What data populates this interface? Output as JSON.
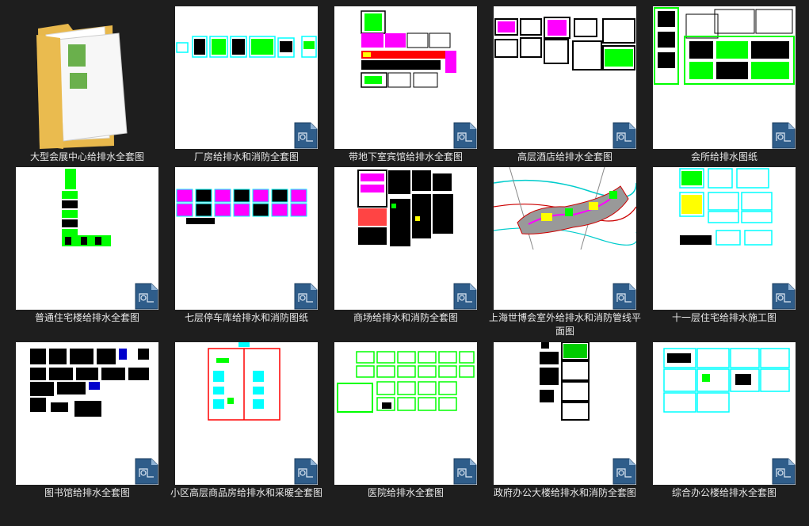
{
  "files": [
    {
      "name": "大型会展中心给排水全套图",
      "kind": "folder"
    },
    {
      "name": "厂房给排水和消防全套图",
      "kind": "dwg"
    },
    {
      "name": "带地下室宾馆给排水全套图",
      "kind": "dwg"
    },
    {
      "name": "高层酒店给排水全套图",
      "kind": "dwg"
    },
    {
      "name": "会所给排水图纸",
      "kind": "dwg"
    },
    {
      "name": "普通住宅楼给排水全套图",
      "kind": "dwg"
    },
    {
      "name": "七层停车库给排水和消防图纸",
      "kind": "dwg"
    },
    {
      "name": "商场给排水和消防全套图",
      "kind": "dwg"
    },
    {
      "name": "上海世博会室外给排水和消防管线平面图",
      "kind": "dwg"
    },
    {
      "name": "十一层住宅给排水施工图",
      "kind": "dwg"
    },
    {
      "name": "图书馆给排水全套图",
      "kind": "dwg"
    },
    {
      "name": "小区高层商品房给排水和采暖全套图",
      "kind": "dwg"
    },
    {
      "name": "医院给排水全套图",
      "kind": "dwg"
    },
    {
      "name": "政府办公大楼给排水和消防全套图",
      "kind": "dwg"
    },
    {
      "name": "综合办公楼给排水全套图",
      "kind": "dwg"
    }
  ],
  "colors": {
    "background": "#1e1e1e",
    "label": "#e8e8e8",
    "thumb": "#ffffff",
    "cad_green": "#00ff00",
    "cad_cyan": "#00ffff",
    "cad_magenta": "#ff00ff",
    "cad_red": "#ff0000",
    "cad_yellow": "#ffff00",
    "cad_black": "#000000"
  }
}
